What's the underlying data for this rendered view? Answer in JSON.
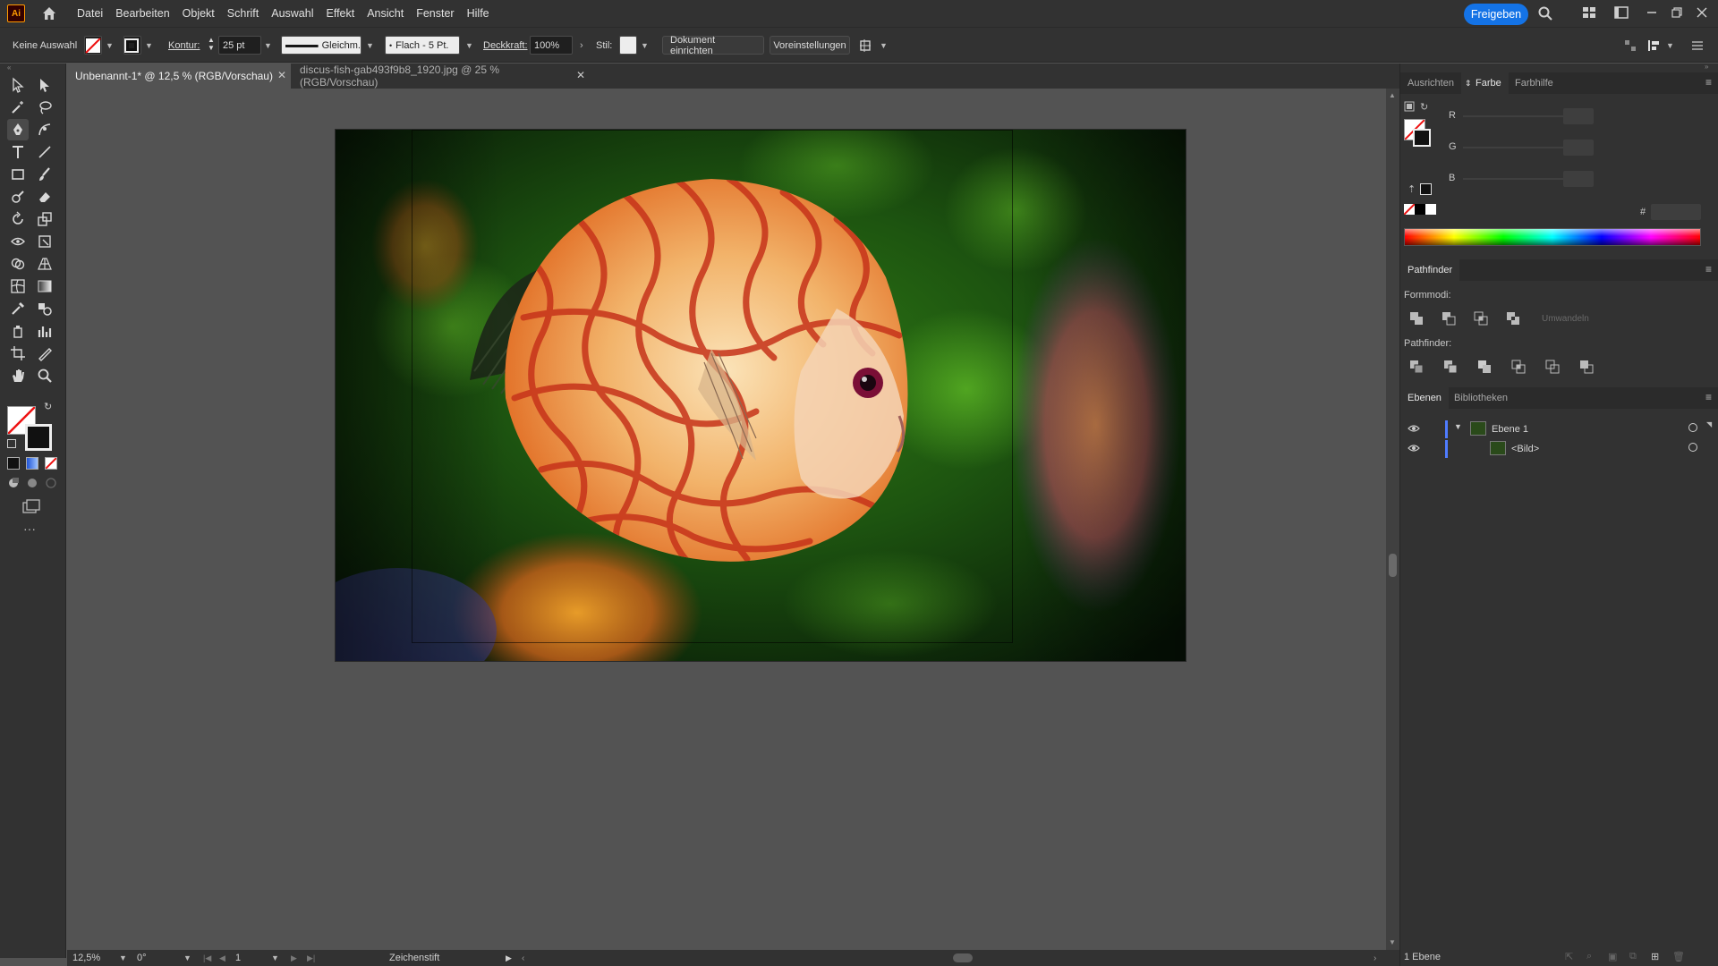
{
  "app": {
    "logo_text": "Ai"
  },
  "menu": {
    "items": [
      "Datei",
      "Bearbeiten",
      "Objekt",
      "Schrift",
      "Auswahl",
      "Effekt",
      "Ansicht",
      "Fenster",
      "Hilfe"
    ],
    "share_label": "Freigeben"
  },
  "control_bar": {
    "selection_label": "Keine Auswahl",
    "stroke_label": "Kontur:",
    "stroke_value": "25 pt",
    "stroke_profile": "Gleichm.",
    "brush_label": "Flach - 5 Pt.",
    "opacity_label": "Deckkraft:",
    "opacity_value": "100%",
    "style_label": "Stil:",
    "document_setup_label": "Dokument einrichten",
    "preferences_label": "Voreinstellungen"
  },
  "tabs": [
    {
      "label": "Unbenannt-1* @ 12,5 % (RGB/Vorschau)",
      "active": true
    },
    {
      "label": "discus-fish-gab493f9b8_1920.jpg @ 25 % (RGB/Vorschau)",
      "active": false
    }
  ],
  "status_bar": {
    "zoom": "12,5%",
    "rotation": "0°",
    "artboard_number": "1",
    "current_tool": "Zeichenstift"
  },
  "color_panel": {
    "tabs": [
      "Ausrichten",
      "Farbe",
      "Farbhilfe"
    ],
    "active_tab": "Farbe",
    "channels": [
      "R",
      "G",
      "B"
    ],
    "hex_label": "#"
  },
  "pathfinder_panel": {
    "title": "Pathfinder",
    "shape_modes_label": "Formmodi:",
    "expand_label": "Umwandeln",
    "pathfinders_label": "Pathfinder:"
  },
  "layers_panel": {
    "tabs": [
      "Ebenen",
      "Bibliotheken"
    ],
    "active_tab": "Ebenen",
    "layers": [
      {
        "name": "Ebene 1",
        "indent": 0,
        "expanded": true
      },
      {
        "name": "<Bild>",
        "indent": 1,
        "expanded": false
      }
    ],
    "layer_count": "1 Ebene"
  },
  "colors": {
    "accent": "#1473e6",
    "layer_color": "#4f7cff",
    "ui_dark": "#323232",
    "canvas": "#535353"
  }
}
